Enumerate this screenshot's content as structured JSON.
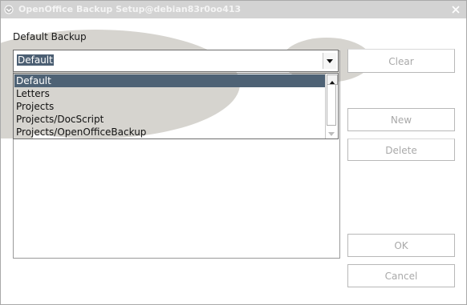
{
  "window": {
    "title": "OpenOffice Backup Setup@debian83r0oo413"
  },
  "main": {
    "label": "Default Backup",
    "combo": {
      "value": "Default"
    },
    "dropdown": {
      "items": [
        "Default",
        "Letters",
        "Projects",
        "Projects/DocScript",
        "Projects/OpenOfficeBackup"
      ],
      "selected_index": 0
    }
  },
  "buttons": {
    "clear": "Clear",
    "new": "New",
    "delete": "Delete",
    "ok": "OK",
    "cancel": "Cancel"
  },
  "colors": {
    "selection": "#4e6275",
    "titlebar": "#d3d3d3",
    "deco_gray": "#d6d4cf"
  }
}
